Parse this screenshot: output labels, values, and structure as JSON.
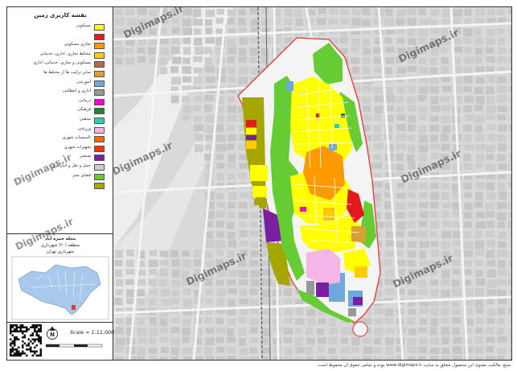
{
  "legend": {
    "title": "نقشه کاربری زمین",
    "items": [
      {
        "label": "مسکونی",
        "color": "#ffff00"
      },
      {
        "label": "",
        "color": "#e31a1c"
      },
      {
        "label": "تجاری مسکونی",
        "color": "#ff9900"
      },
      {
        "label": "مختلط تجاری، اداری، خدماتی",
        "color": "#ffcc00"
      },
      {
        "label": "مسکونی و تجاری، خدماتی، اداری",
        "color": "#b07040"
      },
      {
        "label": "سایر ترکیب ها از مختلط ها",
        "color": "#d9a030"
      },
      {
        "label": "آموزشی",
        "color": "#6fa8dc"
      },
      {
        "label": "اداری و انتظامی",
        "color": "#999999"
      },
      {
        "label": "درمانی",
        "color": "#ff00cc"
      },
      {
        "label": "فرهنگی",
        "color": "#2e7d32"
      },
      {
        "label": "مذهبی",
        "color": "#33ccaa"
      },
      {
        "label": "ورزشی",
        "color": "#f4b6e8"
      },
      {
        "label": "تاسیسات شهری",
        "color": "#ff6600"
      },
      {
        "label": "تجهیزات شهری",
        "color": "#ff3300"
      },
      {
        "label": "صنعتی",
        "color": "#7b1fa2"
      },
      {
        "label": "حمل و نقل و انبارداری",
        "color": "#cccccc"
      },
      {
        "label": "فضای سبز",
        "color": "#66cc33"
      },
      {
        "label": "",
        "color": "#a6a600"
      }
    ]
  },
  "locator": {
    "line1": "محله حمزه آباد",
    "line2": "منطقه (۲۰) شهرداری",
    "line3": "شهرداری تهران"
  },
  "scale_text": "Scale = 1:11,000",
  "footer_text": "منبع: مالکیت معنوی این محصول متعلق به سایت www.digimaps.ir بوده و تمامی حقوق آن محفوظ است.",
  "watermark": "Digimaps.ir",
  "colors": {
    "road_bg": "#dcdcdc",
    "block": "#c8c8c8",
    "boundary": "#e53935",
    "residential": "#ffff00",
    "green": "#66cc33",
    "olive": "#a6a600",
    "orange": "#ff9900",
    "purple": "#7b1fa2",
    "pink": "#f4b6e8",
    "blue": "#6fa8dc",
    "red": "#e31a1c",
    "gray": "#999999"
  }
}
